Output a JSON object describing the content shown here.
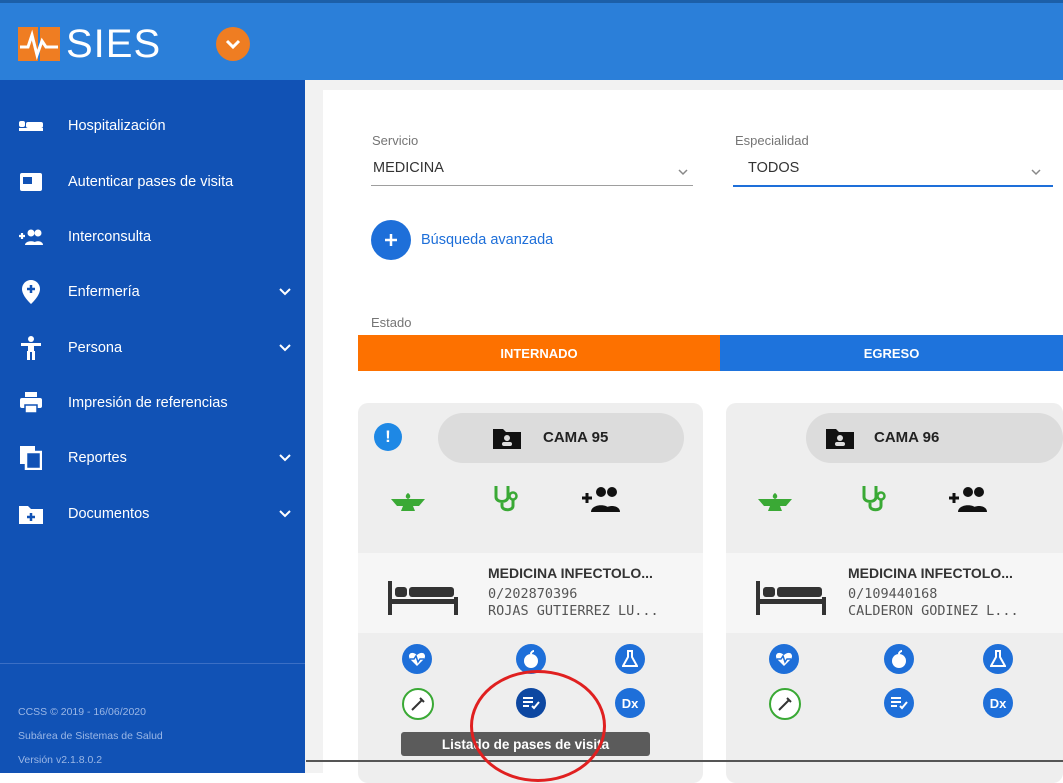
{
  "app": {
    "title": "SIES"
  },
  "colors": {
    "topbar": "#2b7fd9",
    "sidebar": "#1152b5",
    "accent_orange": "#ef7d22",
    "blue": "#1e6fd9",
    "green": "#3aa935"
  },
  "sidebar": {
    "items": [
      {
        "label": "Hospitalización",
        "icon": "hospital-bed-icon",
        "expandable": false
      },
      {
        "label": "Autenticar pases de visita",
        "icon": "id-card-icon",
        "expandable": false
      },
      {
        "label": "Interconsulta",
        "icon": "add-group-icon",
        "expandable": false
      },
      {
        "label": "Enfermería",
        "icon": "location-pin-icon",
        "expandable": true
      },
      {
        "label": "Persona",
        "icon": "person-icon",
        "expandable": true
      },
      {
        "label": "Impresión de referencias",
        "icon": "printer-icon",
        "expandable": false
      },
      {
        "label": "Reportes",
        "icon": "copy-icon",
        "expandable": true
      },
      {
        "label": "Documentos",
        "icon": "folder-plus-icon",
        "expandable": true
      }
    ],
    "footer": {
      "copyright": "CCSS © 2019 - 16/06/2020",
      "org": "Subárea de Sistemas de Salud",
      "version": "Versión v2.1.8.0.2"
    }
  },
  "filters": {
    "servicio": {
      "label": "Servicio",
      "value": "MEDICINA"
    },
    "especialidad": {
      "label": "Especialidad",
      "value": "TODOS"
    },
    "advanced_search": "Búsqueda avanzada"
  },
  "estado": {
    "label": "Estado",
    "tabs": [
      {
        "label": "INTERNADO",
        "active": true
      },
      {
        "label": "EGRESO",
        "active": false
      }
    ]
  },
  "cards": [
    {
      "bed": "CAMA 95",
      "alert": true,
      "service": "MEDICINA INFECTOLO...",
      "id": "0/202870396",
      "name": "ROJAS GUTIERREZ LU..."
    },
    {
      "bed": "CAMA 96",
      "alert": false,
      "service": "MEDICINA INFECTOLO...",
      "id": "0/109440168",
      "name": "CALDERON GODINEZ L..."
    }
  ],
  "action_icons": [
    "heart-monitor-icon",
    "nutrition-icon",
    "lab-flask-icon",
    "syringe-icon",
    "visit-list-icon",
    "diagnosis-icon"
  ],
  "diagnosis_abbr": "Dx",
  "tooltip": "Listado de pases de visita"
}
